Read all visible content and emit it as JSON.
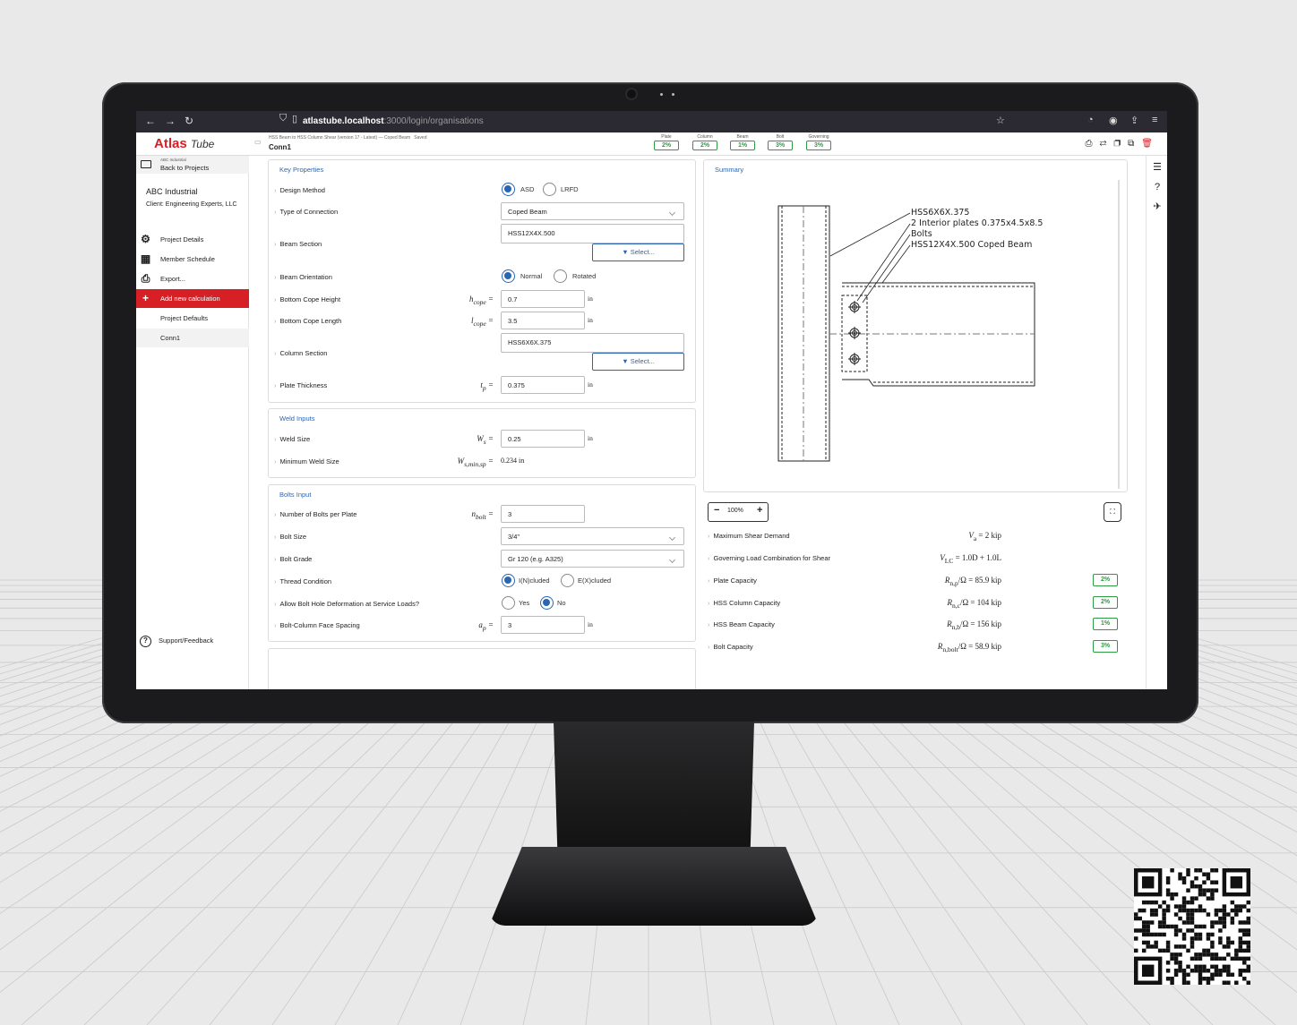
{
  "browser": {
    "url_host": "atlastube.localhost",
    "url_path": ":3000/login/organisations"
  },
  "app": {
    "logo_main": "Atlas",
    "logo_sub": "Tube",
    "breadcrumb": "HSS Beam to HSS Column Shear (version 17 - Latest) — Coped Beam",
    "saved": "Saved",
    "calc_title": "Conn1",
    "governing": [
      {
        "label": "Plate",
        "value": "2%"
      },
      {
        "label": "Column",
        "value": "2%"
      },
      {
        "label": "Beam",
        "value": "1%"
      },
      {
        "label": "Bolt",
        "value": "3%"
      },
      {
        "label": "Governing",
        "value": "3%"
      }
    ]
  },
  "sidebar": {
    "back_small": "ABC Industrial",
    "back_label": "Back to Projects",
    "org": "ABC Industrial",
    "client": "Client: Engineering Experts, LLC",
    "items": [
      {
        "label": "Project Details",
        "icon": "gears-icon"
      },
      {
        "label": "Member Schedule",
        "icon": "grid-icon"
      },
      {
        "label": "Export...",
        "icon": "print-icon"
      },
      {
        "label": "Add new calculation",
        "icon": "plus-icon"
      },
      {
        "label": "Project Defaults"
      },
      {
        "label": "Conn1"
      }
    ],
    "support": "Support/Feedback"
  },
  "key_properties": {
    "title": "Key Properties",
    "design_method": {
      "label": "Design Method",
      "options": [
        "ASD",
        "LRFD"
      ],
      "selected": "ASD"
    },
    "type_of_connection": {
      "label": "Type of Connection",
      "value": "Coped Beam"
    },
    "beam_section": {
      "label": "Beam Section",
      "value": "HSS12X4X.500",
      "button": "Select..."
    },
    "beam_orientation": {
      "label": "Beam Orientation",
      "options": [
        "Normal",
        "Rotated"
      ],
      "selected": "Normal"
    },
    "bottom_cope_height": {
      "label": "Bottom Cope Height",
      "symbol": "h",
      "sub": "cope",
      "value": "0.7",
      "unit": "in"
    },
    "bottom_cope_length": {
      "label": "Bottom Cope Length",
      "symbol": "l",
      "sub": "cope",
      "value": "3.5",
      "unit": "in"
    },
    "column_section": {
      "label": "Column Section",
      "value": "HSS6X6X.375",
      "button": "Select..."
    },
    "plate_thickness": {
      "label": "Plate Thickness",
      "symbol": "t",
      "sub": "p",
      "value": "0.375",
      "unit": "in"
    }
  },
  "weld_inputs": {
    "title": "Weld Inputs",
    "weld_size": {
      "label": "Weld Size",
      "symbol": "W",
      "sub": "s",
      "value": "0.25",
      "unit": "in"
    },
    "min_weld": {
      "label": "Minimum Weld Size",
      "symbol": "W",
      "sub": "s,min,sp",
      "value": "0.234 in"
    }
  },
  "bolts_input": {
    "title": "Bolts Input",
    "num_bolts": {
      "label": "Number of Bolts per Plate",
      "symbol": "n",
      "sub": "bolt",
      "value": "3"
    },
    "bolt_size": {
      "label": "Bolt Size",
      "value": "3/4\""
    },
    "bolt_grade": {
      "label": "Bolt Grade",
      "value": "Gr 120 (e.g. A325)"
    },
    "thread": {
      "label": "Thread Condition",
      "options": [
        "I(N)cluded",
        "E(X)cluded"
      ],
      "selected": "I(N)cluded"
    },
    "deformation": {
      "label": "Allow Bolt Hole Deformation at Service Loads?",
      "options": [
        "Yes",
        "No"
      ],
      "selected": "No"
    },
    "spacing": {
      "label": "Bolt-Column Face Spacing",
      "symbol": "a",
      "sub": "p",
      "value": "3",
      "unit": "in"
    }
  },
  "summary": {
    "title": "Summary",
    "drawing_labels": [
      "HSS6X6X.375",
      "2 Interior plates 0.375x4.5x8.5",
      "Bolts",
      "HSS12X4X.500 Coped Beam"
    ],
    "zoom": "100%",
    "rows": [
      {
        "label": "Maximum Shear Demand",
        "sym": "V",
        "sub": "a",
        "value": "2 kip",
        "pct": ""
      },
      {
        "label": "Governing Load Combination for Shear",
        "sym": "V",
        "sub": "LC",
        "value": "1.0D + 1.0L",
        "pct": ""
      },
      {
        "label": "Plate Capacity",
        "sym": "R",
        "sub": "n,p",
        "value": "85.9 kip",
        "pct": "2%"
      },
      {
        "label": "HSS Column Capacity",
        "sym": "R",
        "sub": "n,c",
        "value": "104 kip",
        "pct": "2%"
      },
      {
        "label": "HSS Beam Capacity",
        "sym": "R",
        "sub": "n,b",
        "value": "156 kip",
        "pct": "1%"
      },
      {
        "label": "Bolt Capacity",
        "sym": "R",
        "sub": "n,bolt",
        "value": "58.9 kip",
        "pct": "3%"
      }
    ]
  },
  "colors": {
    "brand": "#d71f26",
    "accent": "#2b66b3",
    "ok": "#2e9a44"
  }
}
